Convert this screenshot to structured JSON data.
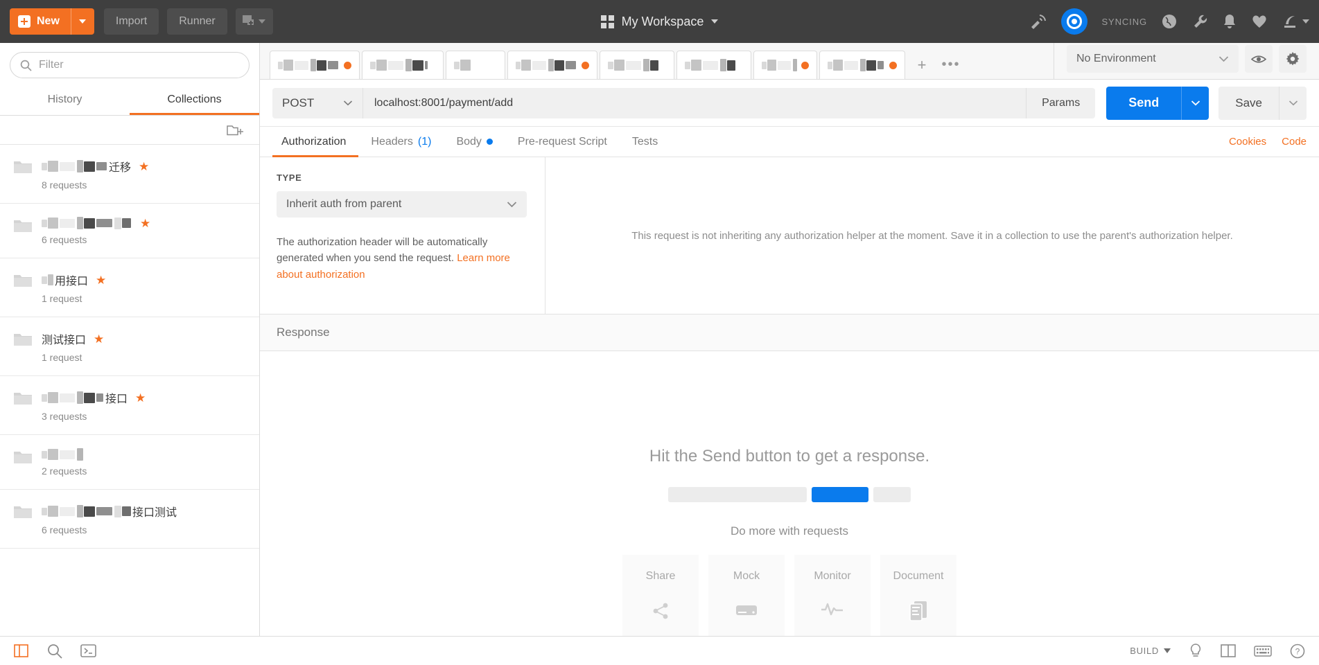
{
  "topbar": {
    "new_label": "New",
    "import_label": "Import",
    "runner_label": "Runner",
    "workspace_title": "My Workspace",
    "sync_label": "SYNCING",
    "icons": [
      "antenna-icon",
      "sync-icon",
      "globe-icon",
      "wrench-icon",
      "bell-icon",
      "heart-icon",
      "account-icon"
    ]
  },
  "sidebar": {
    "filter_placeholder": "Filter",
    "tabs": [
      {
        "label": "History",
        "active": false
      },
      {
        "label": "Collections",
        "active": true
      }
    ],
    "collections": [
      {
        "name_visible": "迁移",
        "redacted_before": 95,
        "count": "8 requests",
        "starred": true
      },
      {
        "name_visible": "",
        "redacted_before": 130,
        "count": "6 requests",
        "starred": true
      },
      {
        "name_visible": "用接口",
        "redacted_before": 18,
        "count": "1 request",
        "starred": true
      },
      {
        "name_visible": "测试接口",
        "redacted_before": 0,
        "count": "1 request",
        "starred": true
      },
      {
        "name_visible": "接口",
        "redacted_before": 90,
        "count": "3 requests",
        "starred": true
      },
      {
        "name_visible": "",
        "redacted_before": 60,
        "count": "2 requests",
        "starred": false
      },
      {
        "name_visible": "接口测试",
        "redacted_before": 130,
        "count": "6 requests",
        "starred": false
      }
    ]
  },
  "tabstrip": {
    "add_label": "+",
    "more_label": "•••",
    "environment": {
      "selected": "No Environment",
      "eye_icon": "eye-icon",
      "gear_icon": "gear-icon"
    }
  },
  "request": {
    "method": "POST",
    "url": "localhost:8001/payment/add",
    "params_label": "Params",
    "send_label": "Send",
    "save_label": "Save",
    "tabs": [
      {
        "label": "Authorization",
        "active": true,
        "badge": ""
      },
      {
        "label": "Headers",
        "active": false,
        "badge": "(1)"
      },
      {
        "label": "Body",
        "active": false,
        "badge": "dot"
      },
      {
        "label": "Pre-request Script",
        "active": false,
        "badge": ""
      },
      {
        "label": "Tests",
        "active": false,
        "badge": ""
      }
    ],
    "cookies_label": "Cookies",
    "code_label": "Code"
  },
  "authorization": {
    "type_label": "TYPE",
    "type_value": "Inherit auth from parent",
    "description": "The authorization header will be automatically generated when you send the request. ",
    "link_text": "Learn more about authorization",
    "inherit_message": "This request is not inheriting any authorization helper at the moment. Save it in a collection to use the parent's authorization helper."
  },
  "response": {
    "header_label": "Response",
    "empty_message": "Hit the Send button to get a response.",
    "do_more_label": "Do more with requests",
    "cards": [
      {
        "label": "Share",
        "icon": "share-icon"
      },
      {
        "label": "Mock",
        "icon": "mock-server-icon"
      },
      {
        "label": "Monitor",
        "icon": "monitor-pulse-icon"
      },
      {
        "label": "Document",
        "icon": "document-icon"
      }
    ]
  },
  "statusbar": {
    "left_icons": [
      "sidebar-toggle-icon",
      "search-icon",
      "console-icon"
    ],
    "build_label": "BUILD",
    "right_icons": [
      "bulb-icon",
      "two-pane-icon",
      "keyboard-icon",
      "help-icon"
    ]
  },
  "colors": {
    "accent_orange": "#f37022",
    "accent_blue": "#0a7bed",
    "topbar_bg": "#3f3f3f"
  }
}
